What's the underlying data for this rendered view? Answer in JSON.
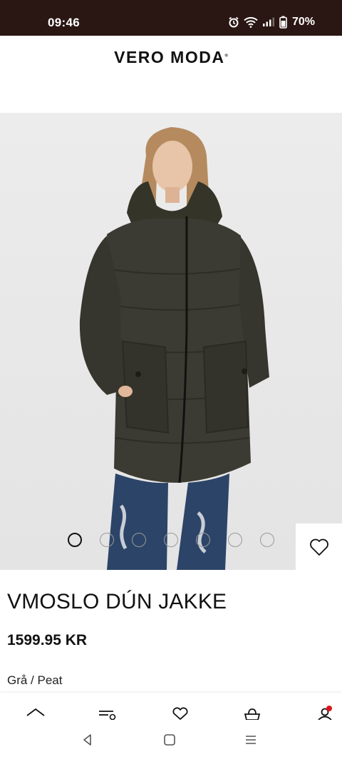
{
  "status_bar": {
    "time": "09:46",
    "battery_percent": "70%",
    "icons": [
      "alarm-icon",
      "wifi-icon",
      "signal-icon",
      "battery-icon"
    ]
  },
  "header": {
    "brand": "VERO MODA",
    "brand_mark": "®"
  },
  "product": {
    "title": "VMOSLO DÚN JAKKE",
    "price": "1599.95 KR",
    "color": "Grå / Peat",
    "image_count": 7,
    "active_image": 1
  },
  "bottom_nav": {
    "items": [
      "home-icon",
      "categories-icon",
      "wishlist-icon",
      "bag-icon",
      "account-icon"
    ],
    "notification_color": "#e0141e"
  },
  "system_nav": {
    "buttons": [
      "back-icon",
      "home-square-icon",
      "recents-icon"
    ]
  },
  "colors": {
    "status_bar_bg": "#2a1613",
    "jacket": "#3c3b33"
  }
}
